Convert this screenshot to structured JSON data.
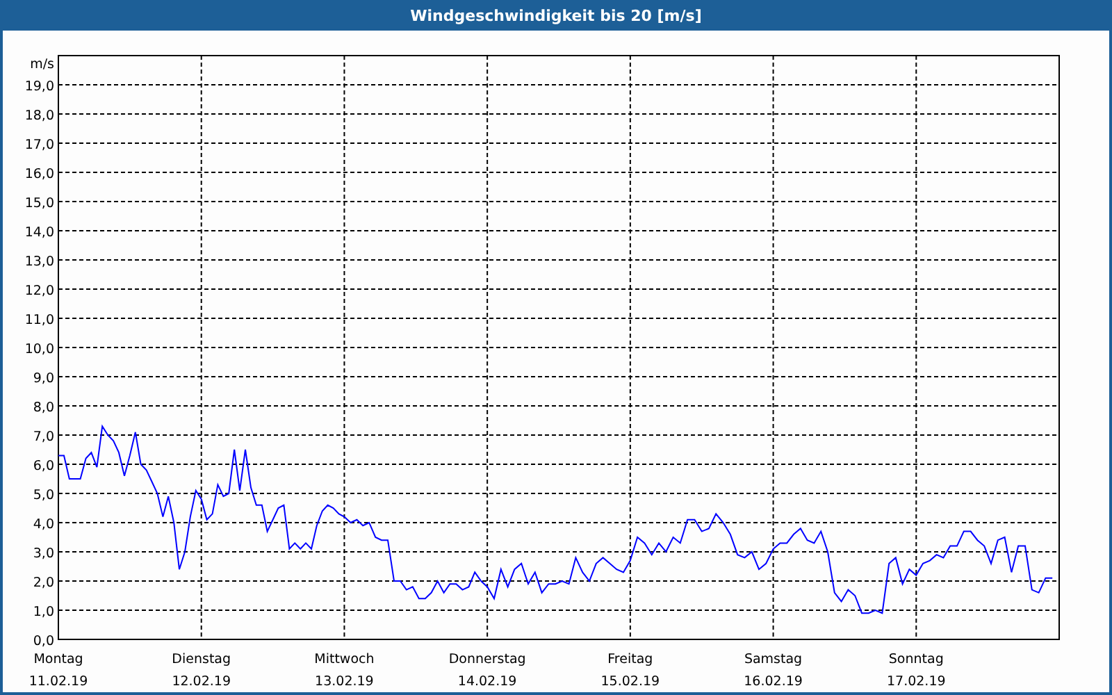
{
  "window": {
    "title": "Windgeschwindigkeit bis 20 [m/s]"
  },
  "chart": {
    "chart_data": {
      "type": "line",
      "ylabel": "m/s",
      "ylim": [
        0,
        20
      ],
      "grid": true,
      "yticks": [
        {
          "value": 0,
          "label": "0,0"
        },
        {
          "value": 1,
          "label": "1,0"
        },
        {
          "value": 2,
          "label": "2,0"
        },
        {
          "value": 3,
          "label": "3,0"
        },
        {
          "value": 4,
          "label": "4,0"
        },
        {
          "value": 5,
          "label": "5,0"
        },
        {
          "value": 6,
          "label": "6,0"
        },
        {
          "value": 7,
          "label": "7,0"
        },
        {
          "value": 8,
          "label": "8,0"
        },
        {
          "value": 9,
          "label": "9,0"
        },
        {
          "value": 10,
          "label": "10,0"
        },
        {
          "value": 11,
          "label": "11,0"
        },
        {
          "value": 12,
          "label": "12,0"
        },
        {
          "value": 13,
          "label": "13,0"
        },
        {
          "value": 14,
          "label": "14,0"
        },
        {
          "value": 15,
          "label": "15,0"
        },
        {
          "value": 16,
          "label": "16,0"
        },
        {
          "value": 17,
          "label": "17,0"
        },
        {
          "value": 18,
          "label": "18,0"
        },
        {
          "value": 19,
          "label": "19,0"
        }
      ],
      "categories": [
        "Montag",
        null,
        null,
        null,
        null,
        null,
        null,
        null,
        null,
        null,
        null,
        null,
        null,
        null,
        null,
        null,
        null,
        null,
        null,
        null,
        null,
        null,
        null,
        null,
        null,
        null,
        "Dienstag",
        null,
        null,
        null,
        null,
        null,
        null,
        null,
        null,
        null,
        null,
        null,
        null,
        null,
        null,
        null,
        null,
        null,
        null,
        null,
        null,
        null,
        null,
        null,
        null,
        null,
        "Mittwoch",
        null,
        null,
        null,
        null,
        null,
        null,
        null,
        null,
        null,
        null,
        null,
        null,
        null,
        null,
        null,
        null,
        null,
        null,
        null,
        null,
        null,
        null,
        "Donnerstag",
        null,
        null,
        null,
        null,
        null,
        null,
        null,
        null,
        null,
        null,
        null,
        null,
        null,
        null,
        null,
        null,
        null,
        null,
        null,
        null,
        "Freitag",
        null,
        null,
        null,
        null,
        null,
        null,
        null,
        null,
        null,
        null,
        null,
        null,
        null,
        null,
        null,
        null,
        null,
        null,
        null,
        "Samstag",
        null,
        null,
        null,
        null,
        null,
        null,
        null,
        null,
        null,
        null,
        null,
        null,
        null,
        null,
        null,
        null,
        null,
        null,
        null,
        null,
        "Sonntag",
        null,
        null,
        null,
        null,
        null,
        null,
        null,
        null,
        null,
        null,
        null,
        null,
        null,
        null,
        null,
        null,
        null,
        null,
        null,
        null
      ],
      "series": [
        {
          "color": "#0000ff",
          "values": [
            6.3,
            6.3,
            5.5,
            5.5,
            5.5,
            6.2,
            6.4,
            5.9,
            7.3,
            7,
            6.8,
            6.4,
            5.6,
            6.3,
            7.1,
            6,
            5.8,
            5.4,
            5,
            4.2,
            4.9,
            4,
            2.4,
            3,
            4.2,
            5.1,
            4.8,
            4.1,
            4.3,
            5.3,
            4.9,
            5,
            6.5,
            5.1,
            6.5,
            5.2,
            4.6,
            4.6,
            3.7,
            4.1,
            4.5,
            4.6,
            3.1,
            3.3,
            3.1,
            3.3,
            3.1,
            3.9,
            4.4,
            4.6,
            4.5,
            4.3,
            4.2,
            4,
            4.1,
            3.9,
            4,
            3.5,
            3.4,
            3.4,
            2,
            2,
            1.7,
            1.8,
            1.4,
            1.4,
            1.6,
            2,
            1.6,
            1.9,
            1.9,
            1.7,
            1.8,
            2.3,
            2,
            1.8,
            1.4,
            2.4,
            1.8,
            2.4,
            2.6,
            1.9,
            2.3,
            1.6,
            1.9,
            1.9,
            2,
            1.9,
            2.8,
            2.3,
            2,
            2.6,
            2.8,
            2.6,
            2.4,
            2.3,
            2.7,
            3.5,
            3.3,
            2.9,
            3.3,
            3,
            3.5,
            3.3,
            4.1,
            4.1,
            3.7,
            3.8,
            4.3,
            4,
            3.6,
            2.9,
            2.8,
            3,
            2.4,
            2.6,
            3.1,
            3.3,
            3.3,
            3.6,
            3.8,
            3.4,
            3.3,
            3.7,
            3,
            1.6,
            1.3,
            1.7,
            1.5,
            0.9,
            0.9,
            1,
            0.9,
            2.6,
            2.8,
            1.9,
            2.4,
            2.2,
            2.6,
            2.7,
            2.9,
            2.8,
            3.2,
            3.2,
            3.7,
            3.7,
            3.4,
            3.2,
            2.6,
            3.4,
            3.5,
            2.3,
            3.2,
            3.2,
            1.7,
            1.6,
            2.1,
            2.1
          ]
        }
      ]
    },
    "date_labels": [
      "11.02.19",
      "12.02.19",
      "13.02.19",
      "14.02.19",
      "15.02.19",
      "16.02.19",
      "17.02.19"
    ]
  }
}
